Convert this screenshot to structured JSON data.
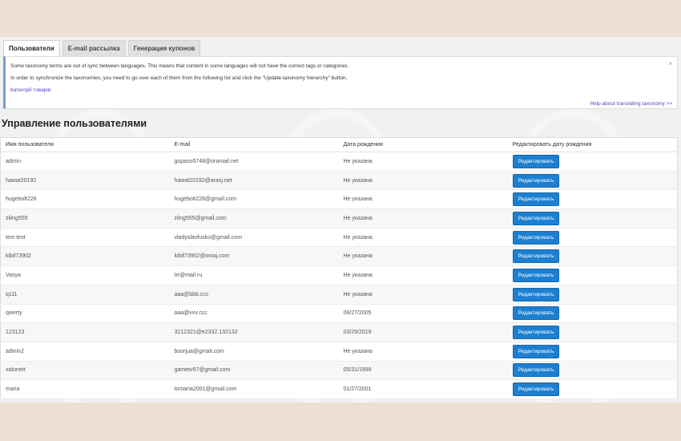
{
  "tabs": [
    {
      "label": "Пользователи",
      "active": true
    },
    {
      "label": "E-mail рассылка",
      "active": false
    },
    {
      "label": "Генерация купонов",
      "active": false
    }
  ],
  "notice": {
    "line1": "Some taxonomy terms are out of sync between languages. This means that content in some languages will not have the correct tags or categories.",
    "line2": "In order to synchronize the taxonomies, you need to go over each of them from the following list and click the \"Update taxonomy hierarchy\" button.",
    "link": "Категорії товарів",
    "more_link": "Help about translating taxonomy >>",
    "dismiss": "×"
  },
  "page_title": "Управление пользователями",
  "table": {
    "headers": {
      "user": "Имя пользователя",
      "email": "E-mail",
      "birthdate": "Дата рождения",
      "edit": "Редактировать дату рождения"
    },
    "button_label": "Редактировать",
    "rows": [
      {
        "user": "admin",
        "email": "gopaso5748@oramail.net",
        "birthdate": "Не указана"
      },
      {
        "user": "hawat20192",
        "email": "hawat20192@arasj.net",
        "birthdate": "Не указана"
      },
      {
        "user": "hugebolt228",
        "email": "hugebolt228@gmail.com",
        "birthdate": "Не указана"
      },
      {
        "user": "ziling555",
        "email": "zilng555@gmail.com",
        "birthdate": "Не указана"
      },
      {
        "user": "test test",
        "email": "vladyslavfusko@gmail.com",
        "birthdate": "Не указана"
      },
      {
        "user": "kibif73902",
        "email": "kibif73902@oniaj.com",
        "birthdate": "Не указана"
      },
      {
        "user": "Vasya",
        "email": "trr@mail.ru",
        "birthdate": "Не указана"
      },
      {
        "user": "q111",
        "email": "aaa@bbb.ccc",
        "birthdate": "Не указана"
      },
      {
        "user": "qwerty",
        "email": "aaa@vvv.ccc",
        "birthdate": "08/27/2005"
      },
      {
        "user": "123123",
        "email": "3212321@e2332.132132",
        "birthdate": "03/29/2019"
      },
      {
        "user": "admin2",
        "email": "boorjua@gmail.com",
        "birthdate": "Не указана"
      },
      {
        "user": "xidonett",
        "email": "gametv57@gmail.com",
        "birthdate": "05/31/1999"
      },
      {
        "user": "maria",
        "email": "tomaria2001@gmail.com",
        "birthdate": "01/27/2001"
      }
    ]
  },
  "colors": {
    "background": "#eedfd2",
    "button": "#1d7fd0",
    "link": "#5b3cc4"
  }
}
